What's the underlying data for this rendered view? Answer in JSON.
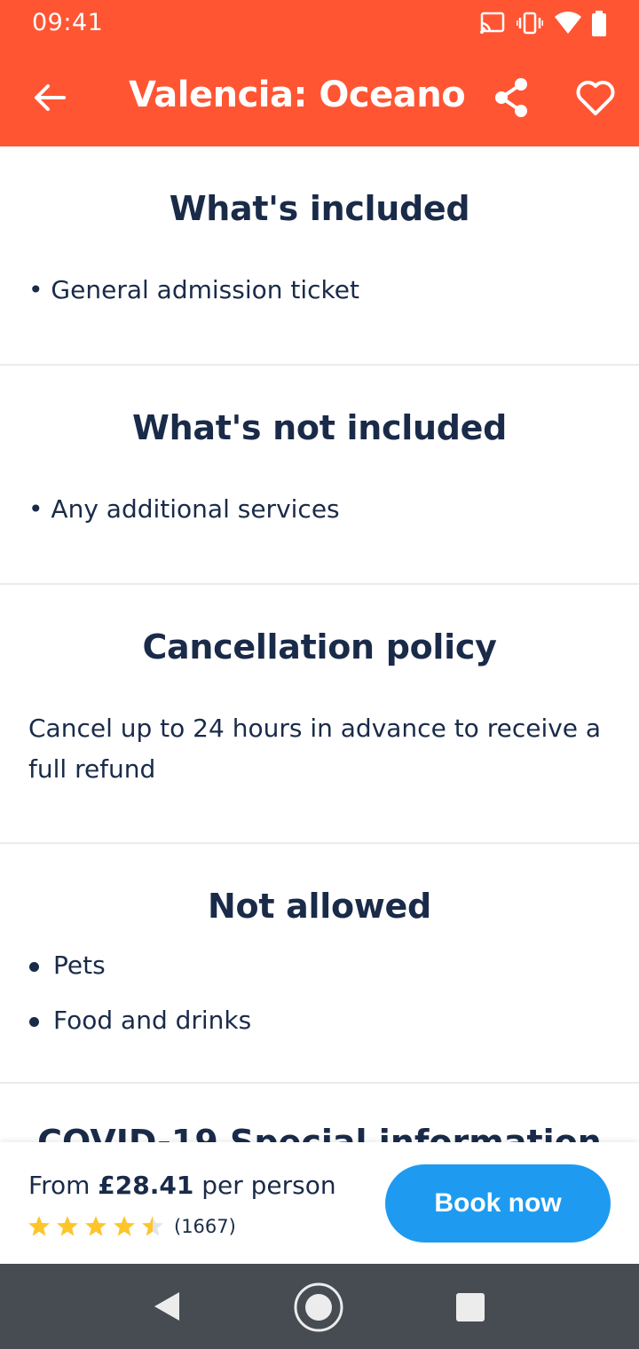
{
  "status_bar": {
    "time": "09:41"
  },
  "app_bar": {
    "title": "Valencia: Oceano...",
    "colors": {
      "background": "#ff5533",
      "foreground": "#ffffff"
    }
  },
  "sections": [
    {
      "title": "What's included",
      "items": [
        "• General admission ticket"
      ]
    },
    {
      "title": "What's not included",
      "items": [
        "• Any additional services"
      ]
    },
    {
      "title": "Cancellation policy",
      "text": "Cancel up to 24 hours in advance to receive a full refund"
    },
    {
      "title": "Not allowed",
      "items": [
        "Pets",
        "Food and drinks"
      ]
    },
    {
      "title": "COVID-19 Special information"
    }
  ],
  "booking": {
    "price_prefix": "From",
    "price": "£28.41",
    "price_suffix": "per person",
    "rating_stars": 4.5,
    "reviews_count": "(1667)",
    "book_label": "Book now",
    "colors": {
      "button": "#1e9bf0",
      "star": "#fdc52a"
    }
  },
  "nav_bar": {
    "icons": [
      "back-icon",
      "home-icon",
      "recents-icon"
    ]
  }
}
